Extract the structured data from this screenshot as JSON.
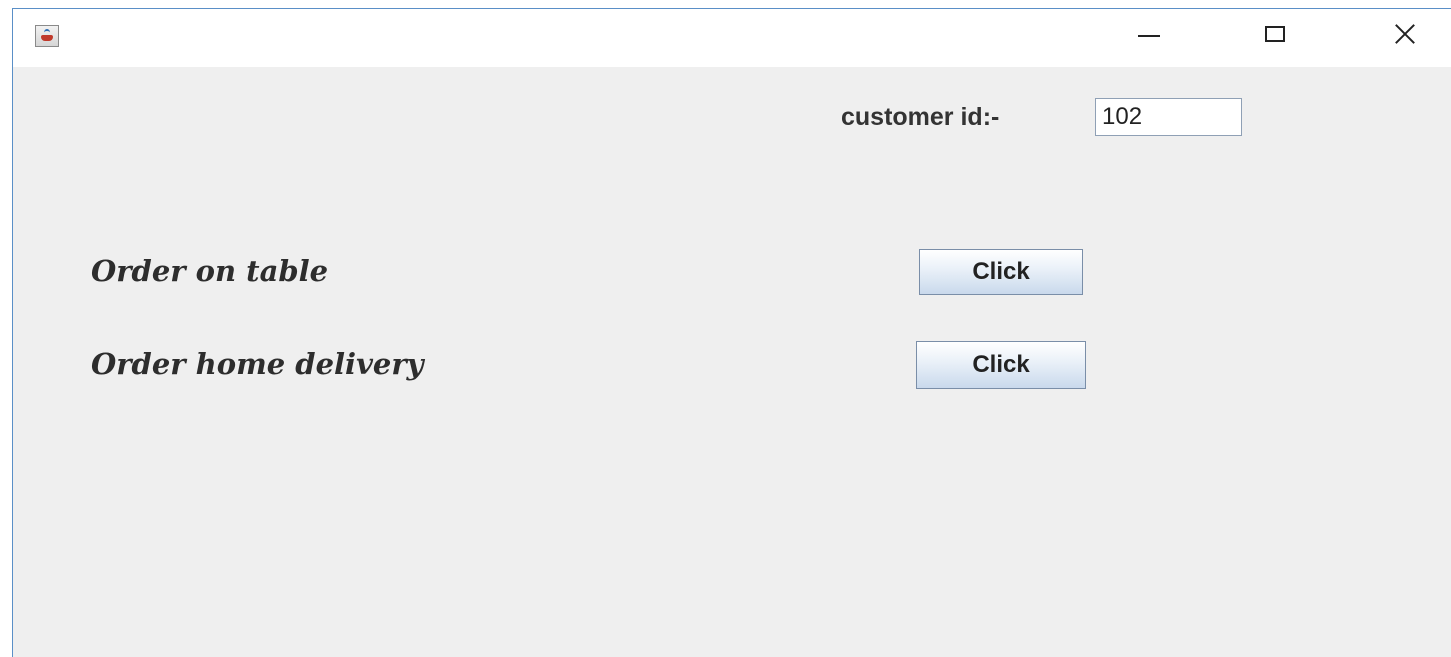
{
  "window": {
    "title": "",
    "icon": "java-cup-icon",
    "controls": {
      "minimize": "minimize-icon",
      "maximize": "maximize-icon",
      "close": "close-icon"
    }
  },
  "customer": {
    "label": "customer id:-",
    "value": "102"
  },
  "orders": [
    {
      "label": "Order on table",
      "button_label": "Click"
    },
    {
      "label": "Order home delivery",
      "button_label": "Click"
    }
  ]
}
